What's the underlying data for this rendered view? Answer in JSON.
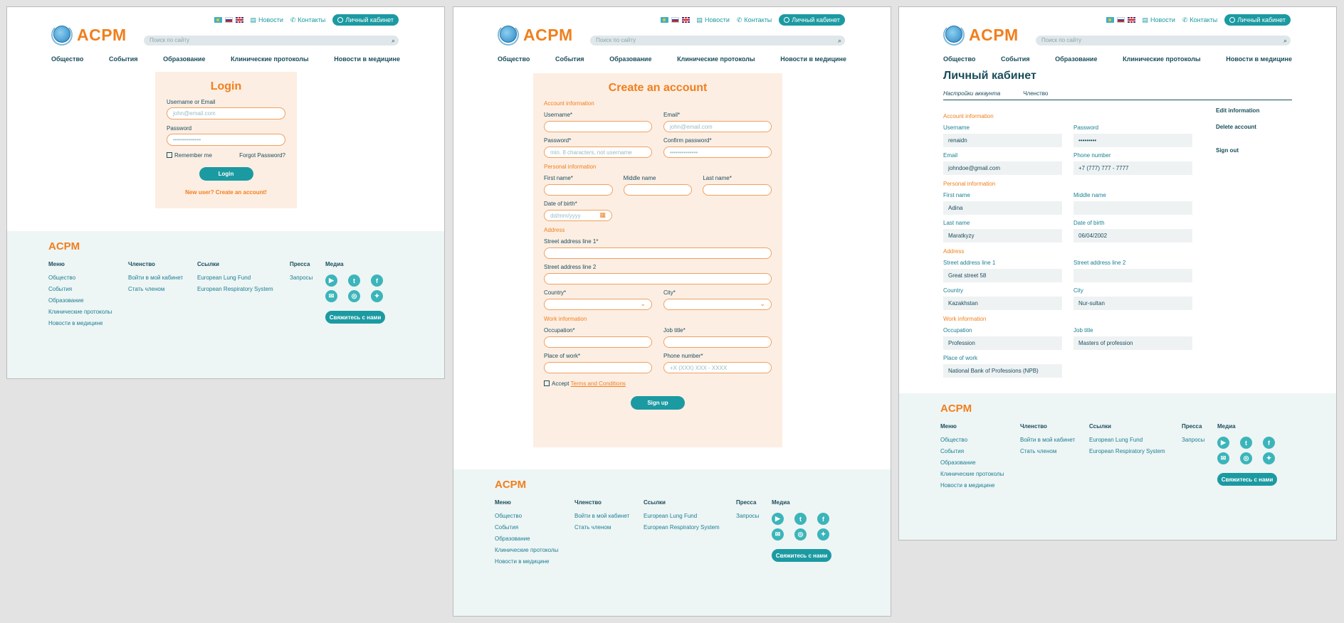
{
  "header": {
    "news": "Новости",
    "contacts": "Контакты",
    "cabinet": "Личный кабинет",
    "logo": "ACPM",
    "search_placeholder": "Поиск по сайту",
    "nav": [
      "Общество",
      "События",
      "Образование",
      "Клинические протоколы",
      "Новости в медицине"
    ]
  },
  "login": {
    "title": "Login",
    "username_label": "Username or Email",
    "username_placeholder": "john@email.com",
    "password_label": "Password",
    "password_placeholder": "••••••••••••••",
    "remember": "Remember me",
    "forgot": "Forgot Password?",
    "button": "Login",
    "new_user": "New user? Create an account!"
  },
  "signup": {
    "title": "Create an account",
    "account_section": "Account information",
    "username": "Username*",
    "email": "Email*",
    "email_placeholder": "john@email.com",
    "password": "Password*",
    "password_placeholder": "min. 8 characters, not username",
    "confirm": "Confirm password*",
    "confirm_placeholder": "••••••••••••••",
    "personal_section": "Personal information",
    "first": "First name*",
    "middle": "Middle name",
    "last": "Last name*",
    "dob": "Date of birth*",
    "dob_placeholder": "dd/mm/yyyy",
    "address_section": "Address",
    "street1": "Street address line 1*",
    "street2": "Street address line 2",
    "country": "Country*",
    "city": "City*",
    "work_section": "Work information",
    "occupation": "Occupation*",
    "job": "Job title*",
    "place": "Place of work*",
    "phone": "Phone number*",
    "phone_placeholder": "+X (XXX) XXX - XXXX",
    "accept": "Accept",
    "terms": "Terms and Conditions",
    "button": "Sign up"
  },
  "cabinet": {
    "title": "Личный кабинет",
    "tab_settings": "Настройки аккаунта",
    "tab_membership": "Членство",
    "account_section": "Account information",
    "username_label": "Username",
    "username": "renaidn",
    "password_label": "Password",
    "password": "•••••••••",
    "email_label": "Email",
    "email": "johndoe@gmail.com",
    "phone_label": "Phone number",
    "phone": "+7 (777) 777 - 7777",
    "personal_section": "Personal information",
    "first_label": "First name",
    "first": "Adina",
    "middle_label": "Middle name",
    "last_label": "Last name",
    "last": "Maratkyzy",
    "dob_label": "Date of birth",
    "dob": "06/04/2002",
    "address_section": "Address",
    "street1_label": "Street address line 1",
    "street1": "Great street 58",
    "street2_label": "Street address line 2",
    "country_label": "Country",
    "country": "Kazakhstan",
    "city_label": "City",
    "city": "Nur-sultan",
    "work_section": "Work information",
    "occupation_label": "Occupation",
    "occupation": "Profession",
    "job_label": "Job title",
    "job": "Masters of profession",
    "place_label": "Place of work",
    "place": "National Bank of Professions (NPB)",
    "edit": "Edit information",
    "delete": "Delete account",
    "signout": "Sign out"
  },
  "footer": {
    "logo": "ACPM",
    "menu_title": "Меню",
    "menu": [
      "Общество",
      "События",
      "Образование",
      "Клинические протоколы",
      "Новости в медицине"
    ],
    "membership_title": "Членство",
    "membership": [
      "Войти в мой кабинет",
      "Стать членом"
    ],
    "links_title": "Ссылки",
    "links": [
      "European Lung Fund",
      "European Respiratory System"
    ],
    "press_title": "Пресса",
    "press": [
      "Запросы"
    ],
    "media_title": "Медиа",
    "contact_btn": "Свяжитесь с нами"
  }
}
